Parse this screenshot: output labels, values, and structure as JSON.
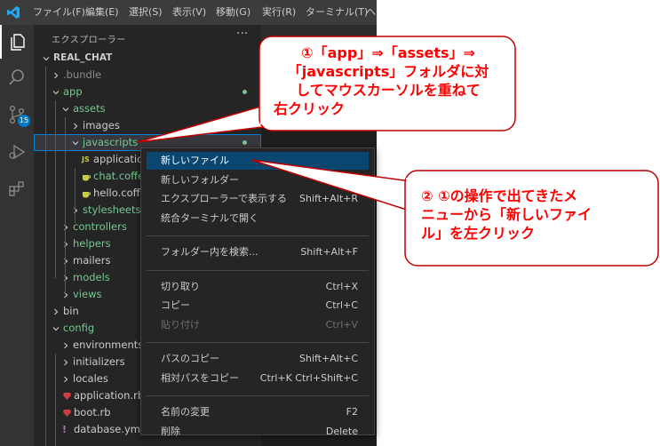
{
  "menubar": [
    "ファイル(F)",
    "編集(E)",
    "選択(S)",
    "表示(V)",
    "移動(G)",
    "実行(R)",
    "ターミナル(T)",
    "ヘ"
  ],
  "activitybar": {
    "scm_badge": "15"
  },
  "sidebar": {
    "title": "エクスプローラー",
    "more": "···",
    "tree": [
      {
        "label": "REAL_CHAT",
        "indent": 0,
        "chev": "down",
        "bold": true
      },
      {
        "label": ".bundle",
        "indent": 1,
        "chev": "right",
        "color": "#8b8b8b"
      },
      {
        "label": "app",
        "indent": 1,
        "chev": "down",
        "color": "#73c991",
        "dot": true
      },
      {
        "label": "assets",
        "indent": 2,
        "chev": "down",
        "color": "#73c991"
      },
      {
        "label": "images",
        "indent": 3,
        "chev": "right"
      },
      {
        "label": "javascripts",
        "indent": 3,
        "chev": "down",
        "color": "#73c991",
        "dot": true,
        "selected": true
      },
      {
        "label": "application.js",
        "indent": 4,
        "icon": "js"
      },
      {
        "label": "chat.coffee",
        "indent": 4,
        "icon": "coffee",
        "color": "#73c991"
      },
      {
        "label": "hello.coffee",
        "indent": 4,
        "icon": "coffee"
      },
      {
        "label": "stylesheets",
        "indent": 3,
        "chev": "right",
        "color": "#73c991"
      },
      {
        "label": "controllers",
        "indent": 2,
        "chev": "right",
        "color": "#73c991"
      },
      {
        "label": "helpers",
        "indent": 2,
        "chev": "right",
        "color": "#73c991"
      },
      {
        "label": "mailers",
        "indent": 2,
        "chev": "right"
      },
      {
        "label": "models",
        "indent": 2,
        "chev": "right",
        "color": "#73c991"
      },
      {
        "label": "views",
        "indent": 2,
        "chev": "right",
        "color": "#73c991"
      },
      {
        "label": "bin",
        "indent": 1,
        "chev": "right"
      },
      {
        "label": "config",
        "indent": 1,
        "chev": "down",
        "color": "#73c991"
      },
      {
        "label": "environments",
        "indent": 2,
        "chev": "right"
      },
      {
        "label": "initializers",
        "indent": 2,
        "chev": "right"
      },
      {
        "label": "locales",
        "indent": 2,
        "chev": "right"
      },
      {
        "label": "application.rb",
        "indent": 2,
        "icon": "ruby"
      },
      {
        "label": "boot.rb",
        "indent": 2,
        "icon": "ruby"
      },
      {
        "label": "database.yml",
        "indent": 2,
        "icon": "yml"
      }
    ]
  },
  "context_menu": {
    "items": [
      {
        "label": "新しいファイル",
        "key": "",
        "highlight": true
      },
      {
        "label": "新しいフォルダー",
        "key": ""
      },
      {
        "label": "エクスプローラーで表示する",
        "key": "Shift+Alt+R"
      },
      {
        "label": "統合ターミナルで開く",
        "key": ""
      },
      {
        "sep": true
      },
      {
        "label": "フォルダー内を検索...",
        "key": "Shift+Alt+F"
      },
      {
        "sep": true
      },
      {
        "label": "切り取り",
        "key": "Ctrl+X"
      },
      {
        "label": "コピー",
        "key": "Ctrl+C"
      },
      {
        "label": "貼り付け",
        "key": "Ctrl+V",
        "disabled": true
      },
      {
        "sep": true
      },
      {
        "label": "パスのコピー",
        "key": "Shift+Alt+C"
      },
      {
        "label": "相対パスをコピー",
        "key": "Ctrl+K Ctrl+Shift+C"
      },
      {
        "sep": true
      },
      {
        "label": "名前の変更",
        "key": "F2"
      },
      {
        "label": "削除",
        "key": "Delete"
      }
    ]
  },
  "callouts": {
    "one": [
      "①「app」⇒「assets」⇒",
      "「javascripts」フォルダに対",
      "してマウスカーソルを重ねて",
      "右クリック"
    ],
    "two": [
      "② ①の操作で出てきたメ",
      "ニューから「新しいファイ",
      "ル」を左クリック"
    ]
  },
  "colors": {
    "callout_border": "#c00000",
    "callout_text": "#ff0000",
    "menu_highlight": "#094771",
    "accent": "#007acc"
  }
}
